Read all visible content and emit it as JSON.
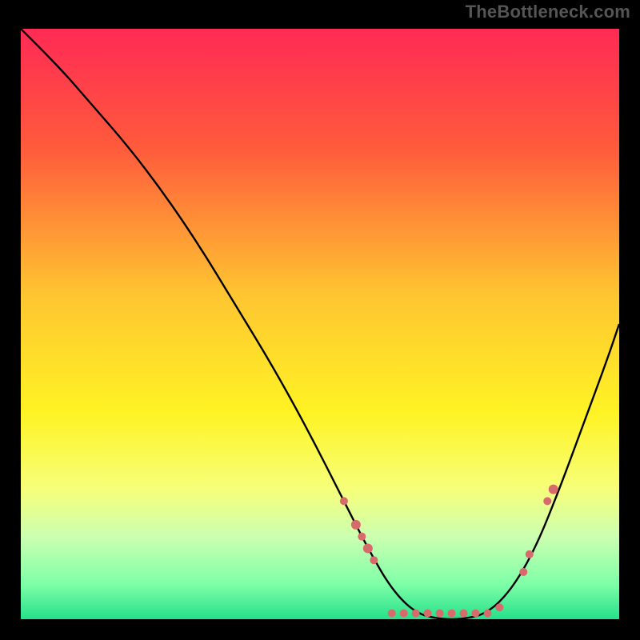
{
  "watermark": "TheBottleneck.com",
  "chart_data": {
    "type": "line",
    "title": "",
    "xlabel": "",
    "ylabel": "",
    "xlim": [
      0,
      100
    ],
    "ylim": [
      0,
      100
    ],
    "grid": false,
    "legend": false,
    "gradient_stops": [
      {
        "offset": 0,
        "color": "#ff2a55"
      },
      {
        "offset": 20,
        "color": "#ff5a3c"
      },
      {
        "offset": 45,
        "color": "#ffc531"
      },
      {
        "offset": 65,
        "color": "#fff324"
      },
      {
        "offset": 78,
        "color": "#f6ff7a"
      },
      {
        "offset": 86,
        "color": "#ccffb0"
      },
      {
        "offset": 94,
        "color": "#7fffa8"
      },
      {
        "offset": 100,
        "color": "#26e08a"
      }
    ],
    "series": [
      {
        "name": "bottleneck-curve",
        "x": [
          0,
          6,
          12,
          18,
          24,
          30,
          36,
          42,
          48,
          54,
          58,
          62,
          66,
          70,
          74,
          78,
          82,
          86,
          90,
          94,
          98,
          100
        ],
        "y": [
          100,
          94,
          87,
          80,
          72,
          63,
          53,
          43,
          32,
          20,
          12,
          5,
          1,
          0,
          0,
          1,
          5,
          12,
          22,
          33,
          44,
          50
        ]
      }
    ],
    "markers": {
      "name": "highlighted-points",
      "color": "#d76a6a",
      "points": [
        {
          "x": 54,
          "y": 20,
          "r": 5
        },
        {
          "x": 56,
          "y": 16,
          "r": 6
        },
        {
          "x": 57,
          "y": 14,
          "r": 5
        },
        {
          "x": 58,
          "y": 12,
          "r": 6
        },
        {
          "x": 59,
          "y": 10,
          "r": 5
        },
        {
          "x": 62,
          "y": 1,
          "r": 5
        },
        {
          "x": 64,
          "y": 1,
          "r": 5
        },
        {
          "x": 66,
          "y": 1,
          "r": 5
        },
        {
          "x": 68,
          "y": 1,
          "r": 5
        },
        {
          "x": 70,
          "y": 1,
          "r": 5
        },
        {
          "x": 72,
          "y": 1,
          "r": 5
        },
        {
          "x": 74,
          "y": 1,
          "r": 5
        },
        {
          "x": 76,
          "y": 1,
          "r": 5
        },
        {
          "x": 78,
          "y": 1,
          "r": 5
        },
        {
          "x": 80,
          "y": 2,
          "r": 5
        },
        {
          "x": 84,
          "y": 8,
          "r": 5
        },
        {
          "x": 85,
          "y": 11,
          "r": 5
        },
        {
          "x": 88,
          "y": 20,
          "r": 5
        },
        {
          "x": 89,
          "y": 22,
          "r": 6
        }
      ]
    }
  }
}
